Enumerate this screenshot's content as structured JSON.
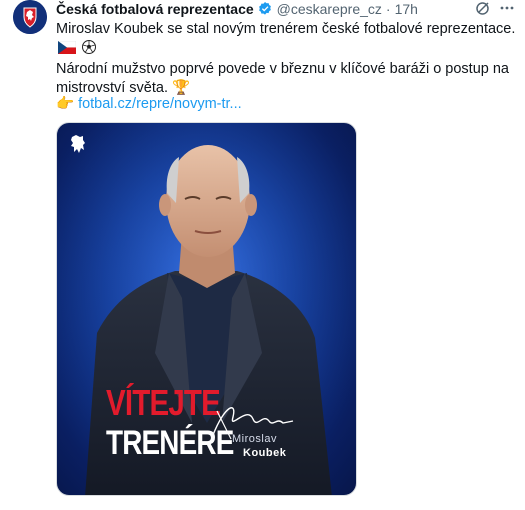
{
  "tweet": {
    "author_name": "Česká fotbalová reprezentace",
    "handle": "@ceskarepre_cz",
    "separator": "·",
    "time": "17h",
    "text_line1": "Miroslav Koubek se stal novým trenérem české fotbalové reprezentace.",
    "text_line2": "Národní mužstvo poprvé povede v březnu v klíčové baráži o postup na",
    "text_line3": "mistrovství světa.",
    "emoji_trophy": "🏆",
    "link_emoji": "👉",
    "link_text": "fotbal.cz/repre/novym-tr..."
  },
  "card": {
    "headline_red": "VÍTEJTE",
    "headline_white": "TRENÉRE",
    "signature": "Koubek",
    "coach_first_name": "Miroslav",
    "coach_last_name": "Koubek"
  },
  "colors": {
    "accent": "#1d9bf0",
    "headline_red": "#e21b2c",
    "card_blue": "#143f9f"
  },
  "icons": [
    "verified-badge-icon",
    "grok-icon",
    "more-icon",
    "czech-flag-icon",
    "soccer-ball-icon",
    "trophy-icon",
    "pointing-hand-icon",
    "lion-crest-icon"
  ]
}
